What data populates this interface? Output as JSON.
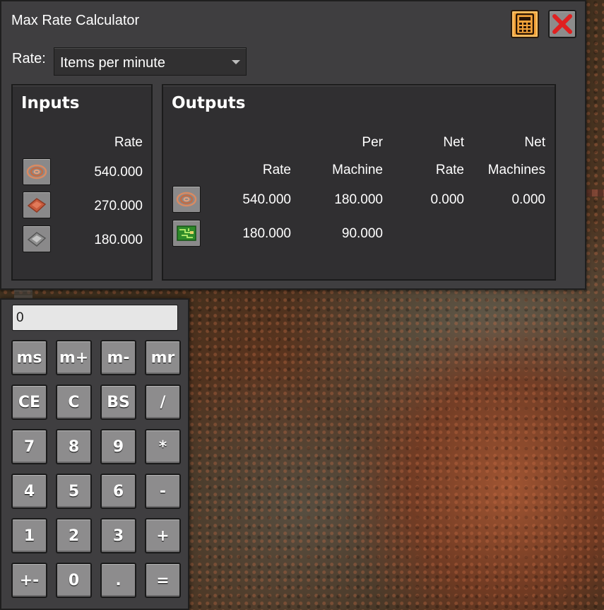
{
  "window": {
    "title": "Max Rate Calculator",
    "calculator_icon": "calculator-icon",
    "close_icon": "close-icon",
    "accent_color": "#f2a23a",
    "close_color": "#e02020"
  },
  "rate": {
    "label": "Rate:",
    "selected": "Items per minute"
  },
  "inputs": {
    "title": "Inputs",
    "header_rate": "Rate",
    "rows": [
      {
        "icon": "copper-cable-icon",
        "rate": "540.000"
      },
      {
        "icon": "copper-plate-icon",
        "rate": "270.000"
      },
      {
        "icon": "iron-plate-icon",
        "rate": "180.000"
      }
    ]
  },
  "outputs": {
    "title": "Outputs",
    "headers": {
      "rate": "Rate",
      "per_line1": "Per",
      "per_line2": "Machine",
      "net_rate_line1": "Net",
      "net_rate_line2": "Rate",
      "net_machines_line1": "Net",
      "net_machines_line2": "Machines"
    },
    "rows": [
      {
        "icon": "copper-cable-icon",
        "rate": "540.000",
        "per_machine": "180.000",
        "net_rate": "0.000",
        "net_machines": "0.000"
      },
      {
        "icon": "electronic-circuit-icon",
        "rate": "180.000",
        "per_machine": "90.000",
        "net_rate": "",
        "net_machines": ""
      }
    ]
  },
  "calculator": {
    "display": "0",
    "keys": [
      [
        "ms",
        "m+",
        "m-",
        "mr"
      ],
      [
        "CE",
        "C",
        "BS",
        "/"
      ],
      [
        "7",
        "8",
        "9",
        "*"
      ],
      [
        "4",
        "5",
        "6",
        "-"
      ],
      [
        "1",
        "2",
        "3",
        "+"
      ],
      [
        "+-",
        "0",
        ".",
        "="
      ]
    ]
  }
}
